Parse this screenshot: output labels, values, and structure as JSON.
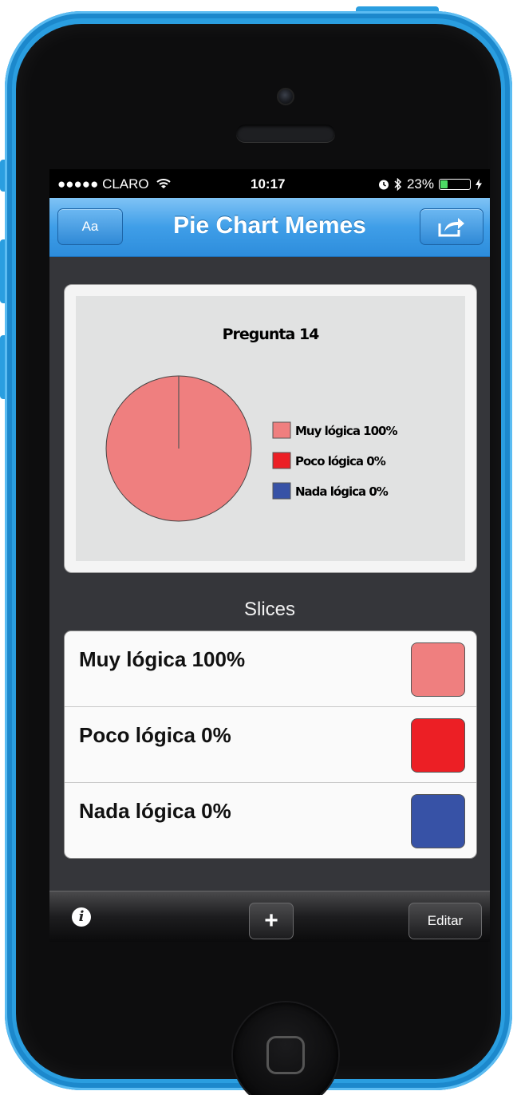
{
  "status_bar": {
    "carrier": "●●●●● CLARO",
    "wifi_icon": "wifi-icon",
    "time": "10:17",
    "alarm_icon": "alarm-clock-icon",
    "bluetooth_icon": "bluetooth-icon",
    "battery_percent": "23%",
    "battery_level": 0.23,
    "battery_color": "#4cd964"
  },
  "nav_bar": {
    "title": "Pie Chart Memes",
    "font_button_label": "Aa",
    "share_icon": "share-icon",
    "accent_color": "#3f9ee8"
  },
  "chart_data": {
    "type": "pie",
    "title": "Pregunta 14",
    "categories": [
      "Muy lógica 100%",
      "Poco lógica 0%",
      "Nada lógica 0%"
    ],
    "values": [
      100,
      0,
      0
    ],
    "colors": [
      "#ef7f7f",
      "#ec1f25",
      "#3752a6"
    ],
    "legend_position": "right"
  },
  "slices_heading": "Slices",
  "slices": [
    {
      "label": "Muy lógica 100%",
      "color": "#ef7f7f"
    },
    {
      "label": "Poco lógica 0%",
      "color": "#ec1f25"
    },
    {
      "label": "Nada lógica 0%",
      "color": "#3752a6"
    }
  ],
  "toolbar": {
    "info_icon": "info-icon",
    "info_symbol": "i",
    "add_label": "+",
    "edit_label": "Editar"
  }
}
